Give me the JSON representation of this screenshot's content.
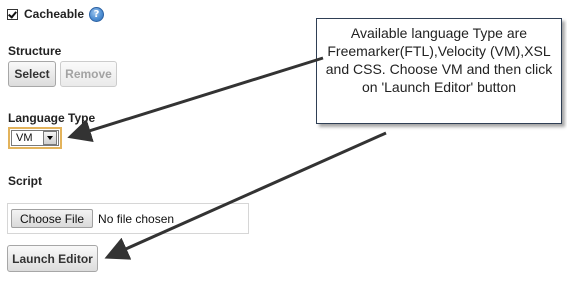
{
  "cacheable": {
    "label": "Cacheable",
    "checked": true,
    "help_icon": "help-question-icon",
    "help_glyph": "?"
  },
  "structure": {
    "label": "Structure",
    "select_button": "Select",
    "remove_button": "Remove"
  },
  "language_type": {
    "label": "Language Type",
    "selected": "VM"
  },
  "script": {
    "label": "Script",
    "choose_file_button": "Choose File",
    "file_status": "No file chosen"
  },
  "launch_editor_button": "Launch Editor",
  "callout": {
    "text": "Available language Type are Freemarker(FTL),Velocity (VM),XSL and CSS. Choose VM and then click on 'Launch Editor' button"
  },
  "colors": {
    "select_focus_border": "#e3b35b",
    "callout_border": "#2f3f55",
    "arrow": "#333333"
  }
}
